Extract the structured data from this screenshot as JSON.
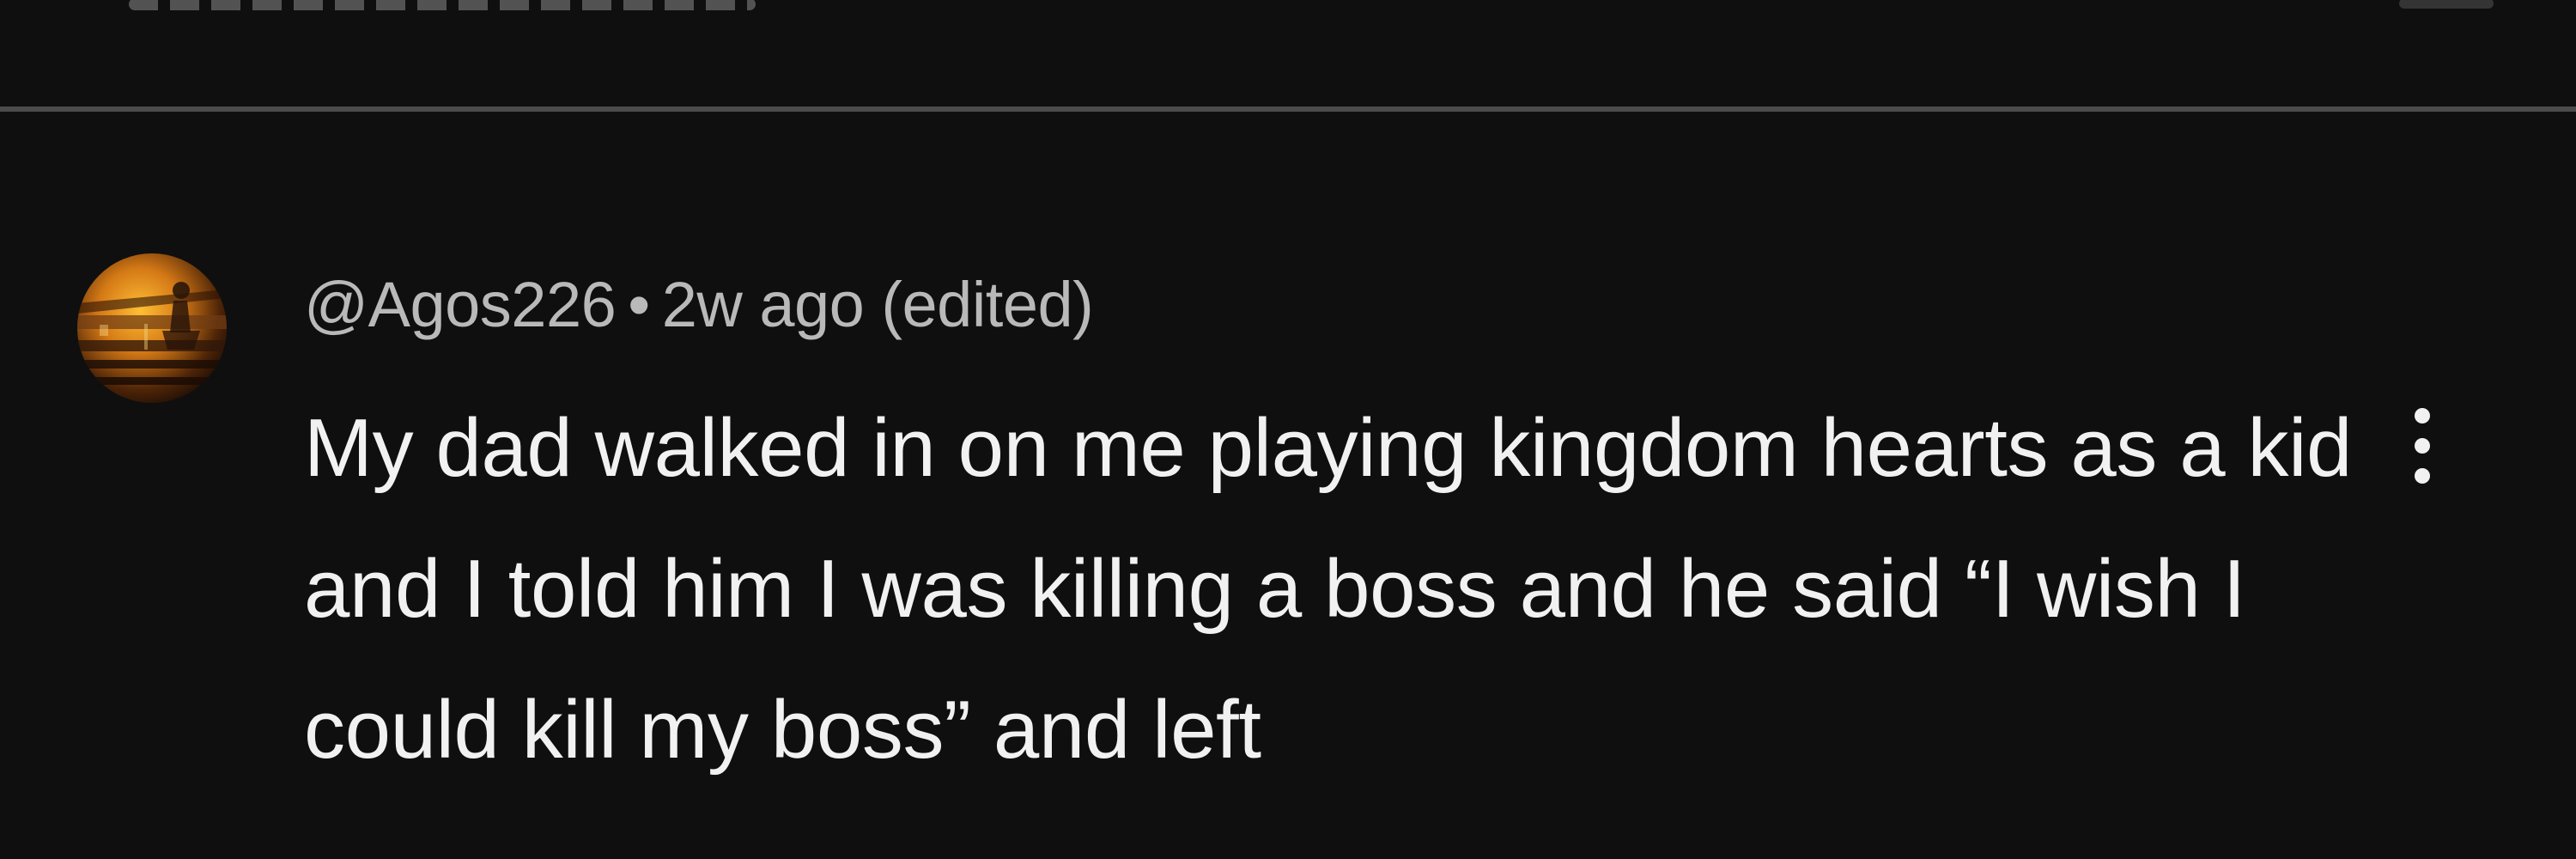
{
  "comment": {
    "author": "@Agos226",
    "separator": "•",
    "time": "2w ago (edited)",
    "text": "My dad walked in on me playing kingdom hearts as a kid and I told him I was killing a boss and he said “I wish I could kill my boss” and left"
  },
  "icons": {
    "avatar": "avatar-image",
    "menu": "more-vertical-icon"
  },
  "colors": {
    "background": "#0f0f0f",
    "divider": "#4b4b4b",
    "metadata": "#b9b9b9",
    "comment_text": "#f1f1f1"
  }
}
